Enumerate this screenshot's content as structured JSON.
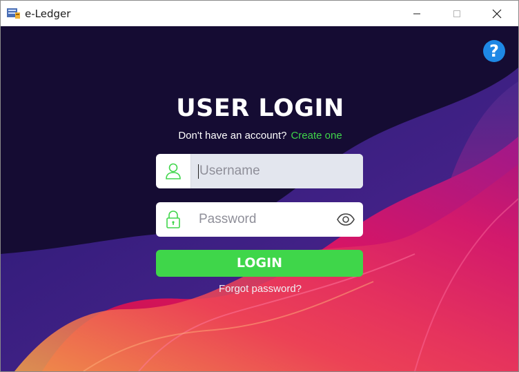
{
  "window": {
    "title": "e-Ledger",
    "icon": "ledger-app-icon",
    "controls": [
      "minimize-icon",
      "maximize-icon",
      "close-icon"
    ]
  },
  "help": {
    "label": "?",
    "icon": "help-icon"
  },
  "login": {
    "heading": "USER LOGIN",
    "no_account_text": "Don't have an account?",
    "create_link": "Create one",
    "username_placeholder": "Username",
    "password_placeholder": "Password",
    "login_button": "LOGIN",
    "forgot_link": "Forgot password?"
  },
  "colors": {
    "background": "#150c33",
    "accent_green": "#3fd64a",
    "help_blue": "#1e88e5",
    "wave_purple": "#3a1d8a",
    "wave_magenta": "#d8156d",
    "wave_orange": "#f6944a"
  }
}
